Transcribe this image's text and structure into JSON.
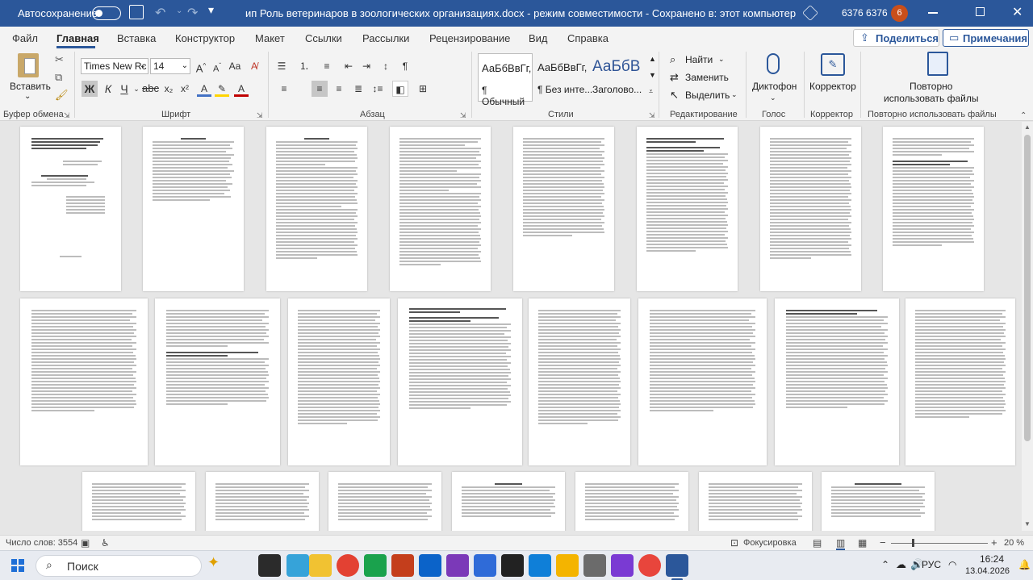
{
  "titlebar": {
    "autosave_label": "Автосохранение",
    "doc_title": "ип Роль ветеринаров в зоологических организациях.docx  -  режим совместимости  -  Сохранено в: этот компьютер",
    "user_name": "6376 6376",
    "user_initials": "6"
  },
  "tabs": [
    "Файл",
    "Главная",
    "Вставка",
    "Конструктор",
    "Макет",
    "Ссылки",
    "Рассылки",
    "Рецензирование",
    "Вид",
    "Справка"
  ],
  "share_label": "Поделиться",
  "comments_label": "Примечания",
  "ribbon": {
    "paste_label": "Вставить",
    "clipboard_group": "Буфер обмена",
    "font_group": "Шрифт",
    "font_name": "Times New Rc",
    "font_size": "14",
    "paragraph_group": "Абзац",
    "styles_group": "Стили",
    "styles": [
      {
        "preview": "АаБбВвГг,",
        "name": "¶ Обычный"
      },
      {
        "preview": "АаБбВвГг,",
        "name": "¶ Без инте..."
      },
      {
        "preview": "АаБбВ",
        "name": "Заголово..."
      }
    ],
    "find_label": "Найти",
    "replace_label": "Заменить",
    "select_label": "Выделить",
    "editing_group": "Редактирование",
    "dictation_label": "Диктофон",
    "voice_group": "Голос",
    "editor_label": "Корректор",
    "editor_group": "Корректор",
    "reuse_label_1": "Повторно",
    "reuse_label_2": "использовать файлы",
    "reuse_group": "Повторно использовать файлы"
  },
  "status": {
    "word_count": "Число слов: 3554",
    "focus_label": "Фокусировка",
    "zoom": "20 %"
  },
  "taskbar": {
    "search_placeholder": "Поиск",
    "lang": "РУС",
    "time": "16:24",
    "date": "13.04.2026"
  }
}
